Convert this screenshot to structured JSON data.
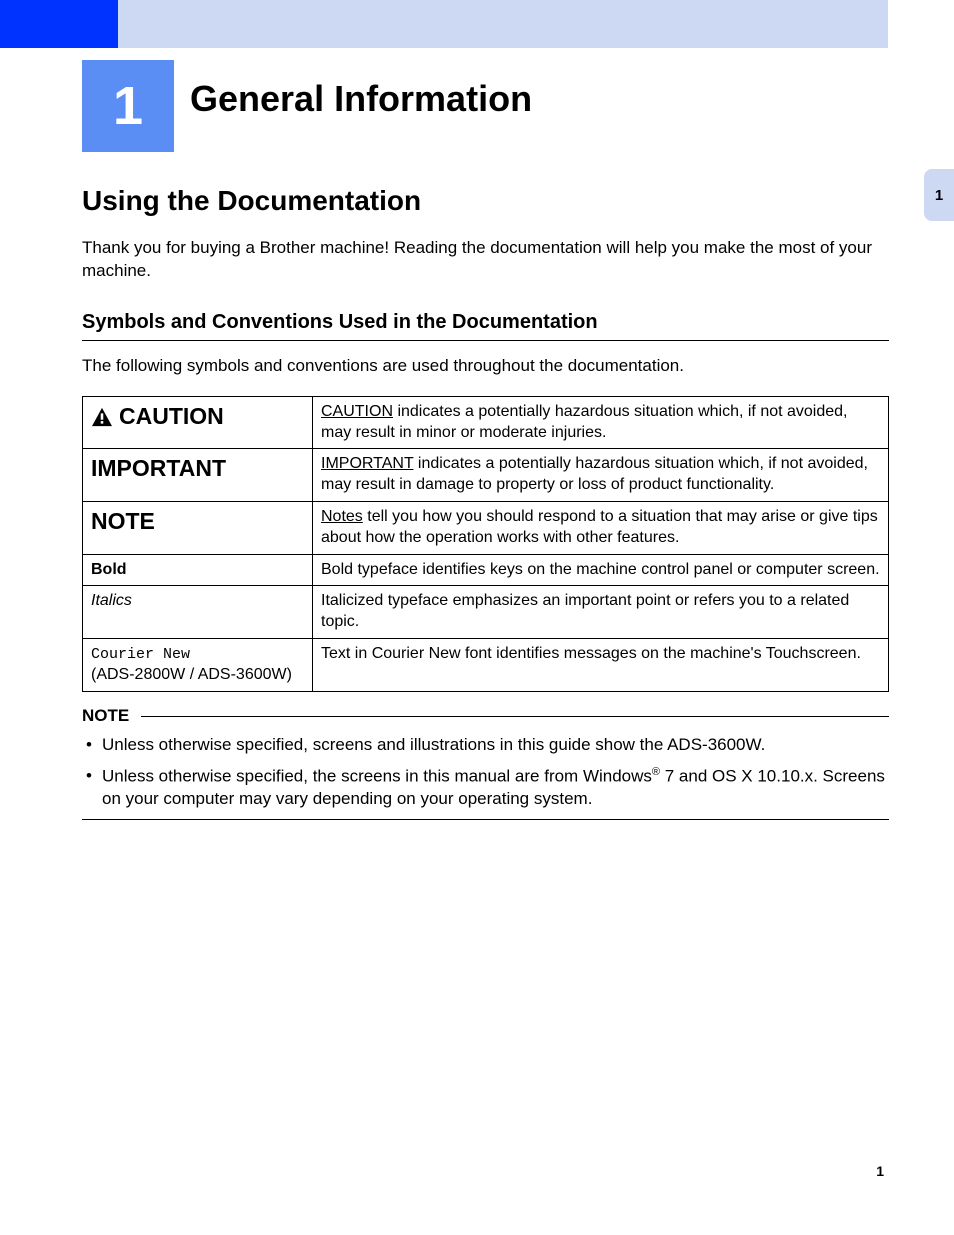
{
  "chapter": {
    "number": "1",
    "title": "General Information"
  },
  "side_tab": "1",
  "section": {
    "title": "Using the Documentation",
    "intro": "Thank you for buying a Brother machine! Reading the documentation will help you make the most of your machine."
  },
  "subsection": {
    "title": "Symbols and Conventions Used in the Documentation",
    "intro": "The following symbols and conventions are used throughout the documentation."
  },
  "table": {
    "rows": [
      {
        "label": "CAUTION",
        "desc_lead": "CAUTION",
        "desc_rest": " indicates a potentially hazardous situation which, if not avoided, may result in minor or moderate injuries."
      },
      {
        "label": "IMPORTANT",
        "desc_lead": "IMPORTANT",
        "desc_rest": " indicates a potentially hazardous situation which, if not avoided, may result in damage to property or loss of product functionality."
      },
      {
        "label": "NOTE",
        "desc_lead": "Notes",
        "desc_rest": " tell you how you should respond to a situation that may arise or give tips about how the operation works with other features."
      },
      {
        "label": "Bold",
        "desc": "Bold typeface identifies keys on the machine control panel or computer screen."
      },
      {
        "label": "Italics",
        "desc": "Italicized typeface emphasizes an important point or refers you to a related topic."
      },
      {
        "label_mono": "Courier New",
        "label_sub": "(ADS-2800W / ADS-3600W)",
        "desc": "Text in Courier New font identifies messages on the machine's Touchscreen."
      }
    ]
  },
  "note_box": {
    "header": "NOTE",
    "items": [
      "Unless otherwise specified, screens and illustrations in this guide show the ADS-3600W.",
      {
        "pre": "Unless otherwise specified, the screens in this manual are from Windows",
        "sup": "®",
        "post": " 7 and OS X 10.10.x. Screens on your computer may vary depending on your operating system."
      }
    ]
  },
  "page_number": "1"
}
